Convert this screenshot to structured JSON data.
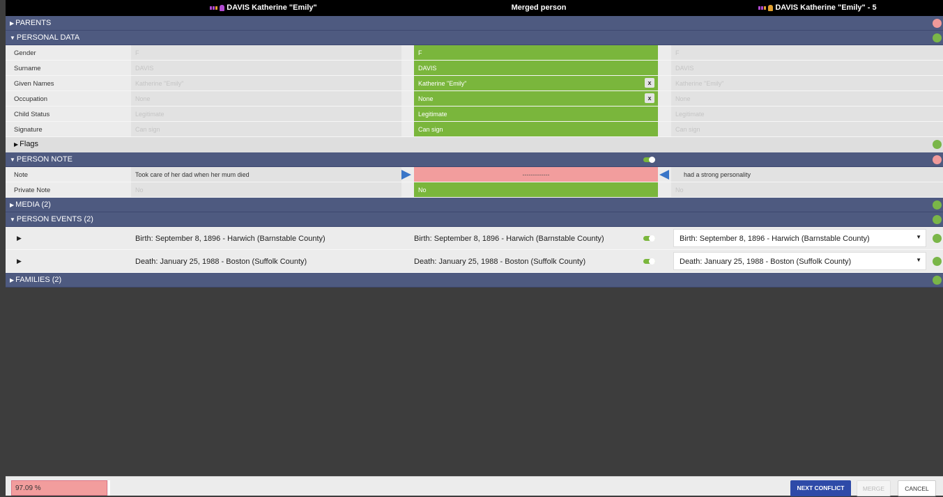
{
  "header": {
    "left_title": "DAVIS Katherine \"Emily\"",
    "middle_title": "Merged person",
    "right_title": "DAVIS Katherine \"Emily\" - 5"
  },
  "sections": {
    "parents": "PARENTS",
    "personal_data": "PERSONAL DATA",
    "flags": "Flags",
    "person_note": "PERSON NOTE",
    "media": "MEDIA (2)",
    "person_events": "PERSON EVENTS (2)",
    "families": "FAMILIES (2)"
  },
  "personal_rows": [
    {
      "label": "Gender",
      "left": "F",
      "merged": "F",
      "right": "F"
    },
    {
      "label": "Surname",
      "left": "DAVIS",
      "merged": "DAVIS",
      "right": "DAVIS"
    },
    {
      "label": "Given Names",
      "left": "Katherine \"Emily\"",
      "merged": "Katherine \"Emily\"",
      "right": "Katherine \"Emily\""
    },
    {
      "label": "Occupation",
      "left": "None",
      "merged": "None",
      "right": "None"
    },
    {
      "label": "Child Status",
      "left": "Legitimate",
      "merged": "Legitimate",
      "right": "Legitimate"
    },
    {
      "label": "Signature",
      "left": "Can sign",
      "merged": "Can sign",
      "right": "Can sign"
    }
  ],
  "clear_button": "x",
  "note_rows": [
    {
      "label": "Note",
      "left": "Took care of her dad when her mum died",
      "merged": "-------------",
      "right": "had a strong personality"
    },
    {
      "label": "Private Note",
      "left": "No",
      "merged": "No",
      "right": "No"
    }
  ],
  "events": [
    {
      "left": "Birth: September 8, 1896 - Harwich (Barnstable County)",
      "merged": "Birth: September 8, 1896 - Harwich (Barnstable County)",
      "selected": "Birth: September 8, 1896 - Harwich (Barnstable County)"
    },
    {
      "left": "Death: January 25, 1988 - Boston (Suffolk County)",
      "merged": "Death: January 25, 1988 - Boston (Suffolk County)",
      "selected": "Death: January 25, 1988 - Boston (Suffolk County)"
    }
  ],
  "footer": {
    "progress": "97.09 %",
    "next_conflict": "NEXT CONFLICT",
    "merge": "MERGE",
    "cancel": "CANCEL"
  },
  "colors": {
    "section_bg": "#4e5a80",
    "merged_green": "#7ab63c",
    "conflict_red": "#f29d9d",
    "ok_dot": "#7ab648",
    "conflict_dot": "#f09a9a",
    "primary_button": "#2e4aa8"
  }
}
